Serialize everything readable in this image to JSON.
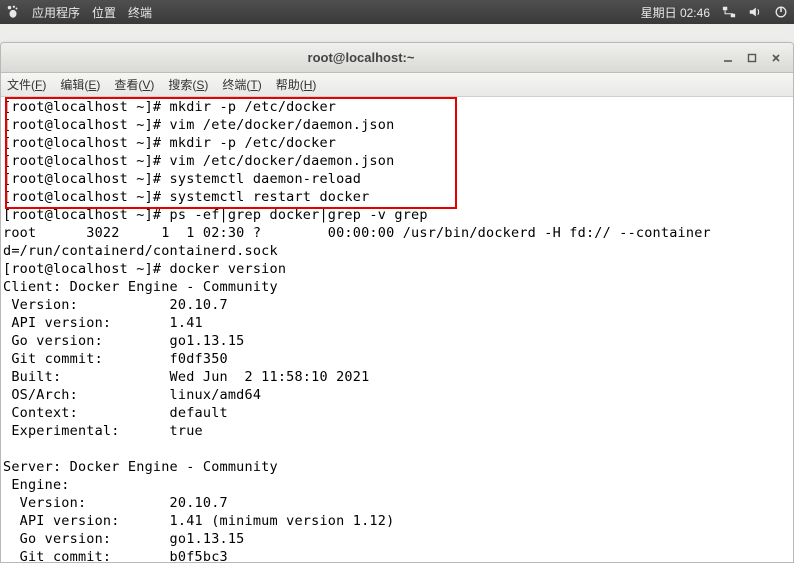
{
  "panel": {
    "apps": "应用程序",
    "places": "位置",
    "term": "终端",
    "date": "星期日 02:46"
  },
  "win": {
    "title": "root@localhost:~"
  },
  "menu": {
    "file": "文件(",
    "file_u": "F",
    "edit": "编辑(",
    "edit_u": "E",
    "view": "查看(",
    "view_u": "V",
    "search": "搜索(",
    "search_u": "S",
    "terminal": "终端(",
    "terminal_u": "T",
    "help": "帮助(",
    "help_u": "H",
    "close_paren": ")"
  },
  "t": {
    "l1": "[root@localhost ~]# mkdir -p /etc/docker",
    "l2": "[root@localhost ~]# vim /ete/docker/daemon.json",
    "l3": "[root@localhost ~]# mkdir -p /etc/docker",
    "l4": "[root@localhost ~]# vim /etc/docker/daemon.json",
    "l5": "[root@localhost ~]# systemctl daemon-reload",
    "l6": "[root@localhost ~]# systemctl restart docker",
    "l7": "[root@localhost ~]# ps -ef|grep docker|grep -v grep",
    "l8": "root      3022     1  1 02:30 ?        00:00:00 /usr/bin/dockerd -H fd:// --container",
    "l9": "d=/run/containerd/containerd.sock",
    "l10": "[root@localhost ~]# docker version",
    "l11": "Client: Docker Engine - Community",
    "l12": " Version:           20.10.7",
    "l13": " API version:       1.41",
    "l14": " Go version:        go1.13.15",
    "l15": " Git commit:        f0df350",
    "l16": " Built:             Wed Jun  2 11:58:10 2021",
    "l17": " OS/Arch:           linux/amd64",
    "l18": " Context:           default",
    "l19": " Experimental:      true",
    "l20": "",
    "l21": "Server: Docker Engine - Community",
    "l22": " Engine:",
    "l23": "  Version:          20.10.7",
    "l24": "  API version:      1.41 (minimum version 1.12)",
    "l25": "  Go version:       go1.13.15",
    "l26": "  Git commit:       b0f5bc3"
  }
}
